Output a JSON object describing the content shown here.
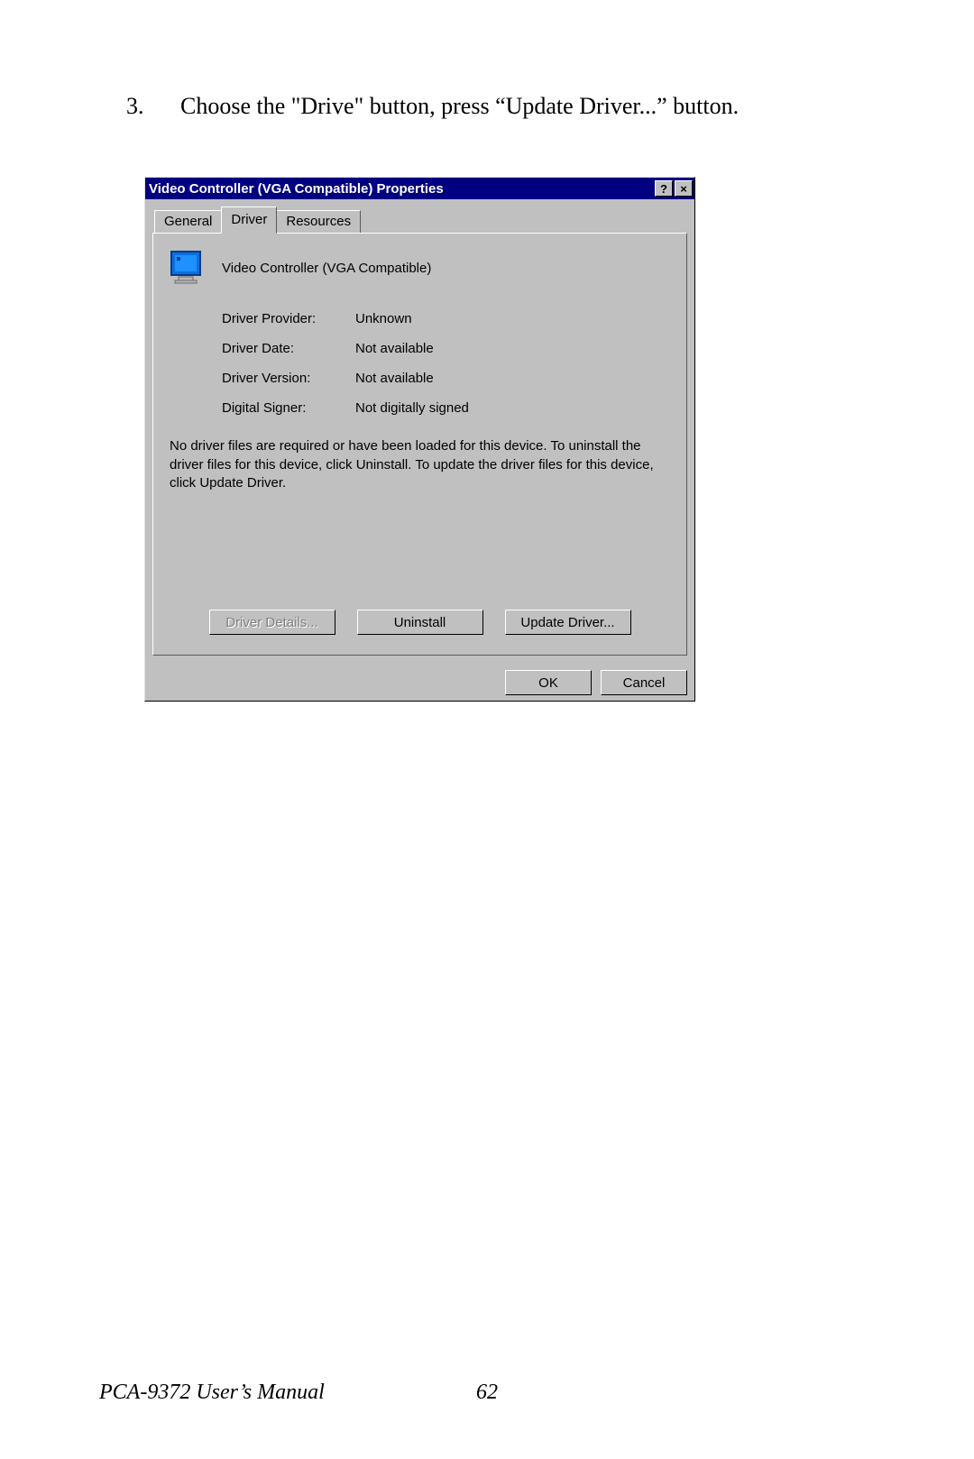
{
  "instruction": {
    "number": "3.",
    "text": "Choose the \"Drive\" button, press “Update Driver...” button."
  },
  "dialog": {
    "title": "Video Controller (VGA Compatible) Properties",
    "help_glyph": "?",
    "close_glyph": "×",
    "tabs": {
      "general": "General",
      "driver": "Driver",
      "resources": "Resources"
    },
    "device_name": "Video Controller (VGA Compatible)",
    "info": {
      "provider_label": "Driver Provider:",
      "provider_value": "Unknown",
      "date_label": "Driver Date:",
      "date_value": "Not available",
      "version_label": "Driver Version:",
      "version_value": "Not available",
      "signer_label": "Digital Signer:",
      "signer_value": "Not digitally signed"
    },
    "description": "No driver files are required or have been loaded for this device. To uninstall the driver files for this device, click Uninstall. To update the driver files for this device, click Update Driver.",
    "buttons": {
      "details": "Driver Details...",
      "uninstall": "Uninstall",
      "update": "Update Driver..."
    },
    "footer_buttons": {
      "ok": "OK",
      "cancel": "Cancel"
    }
  },
  "footer": {
    "manual": "PCA-9372 User’s Manual",
    "page": "62"
  }
}
